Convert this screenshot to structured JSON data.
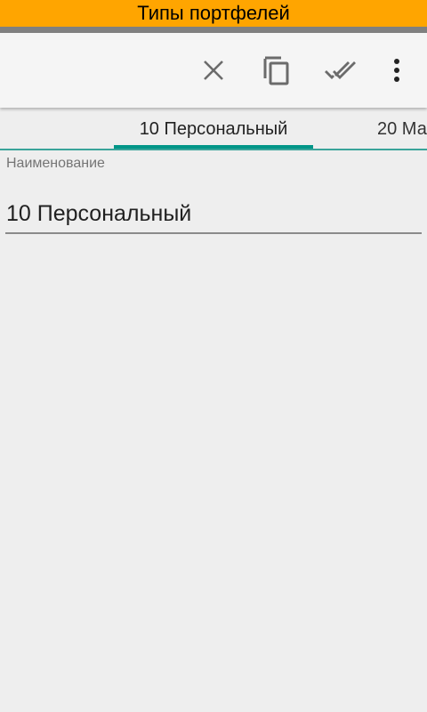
{
  "title_bar": {
    "title": "Типы портфелей",
    "color": "#ffa500"
  },
  "toolbar": {
    "actions": [
      {
        "name": "close",
        "icon": "close-icon"
      },
      {
        "name": "copy",
        "icon": "copy-icon"
      },
      {
        "name": "done-all",
        "icon": "double-check-icon"
      },
      {
        "name": "more",
        "icon": "more-vert-icon"
      }
    ]
  },
  "tabs": {
    "items": [
      {
        "label": "10 Персональный",
        "active": true
      },
      {
        "label": "20 Ма",
        "active": false
      }
    ],
    "indicator_color": "#009688"
  },
  "form": {
    "name_field": {
      "label": "Наименование",
      "value": "10 Персональный"
    }
  }
}
